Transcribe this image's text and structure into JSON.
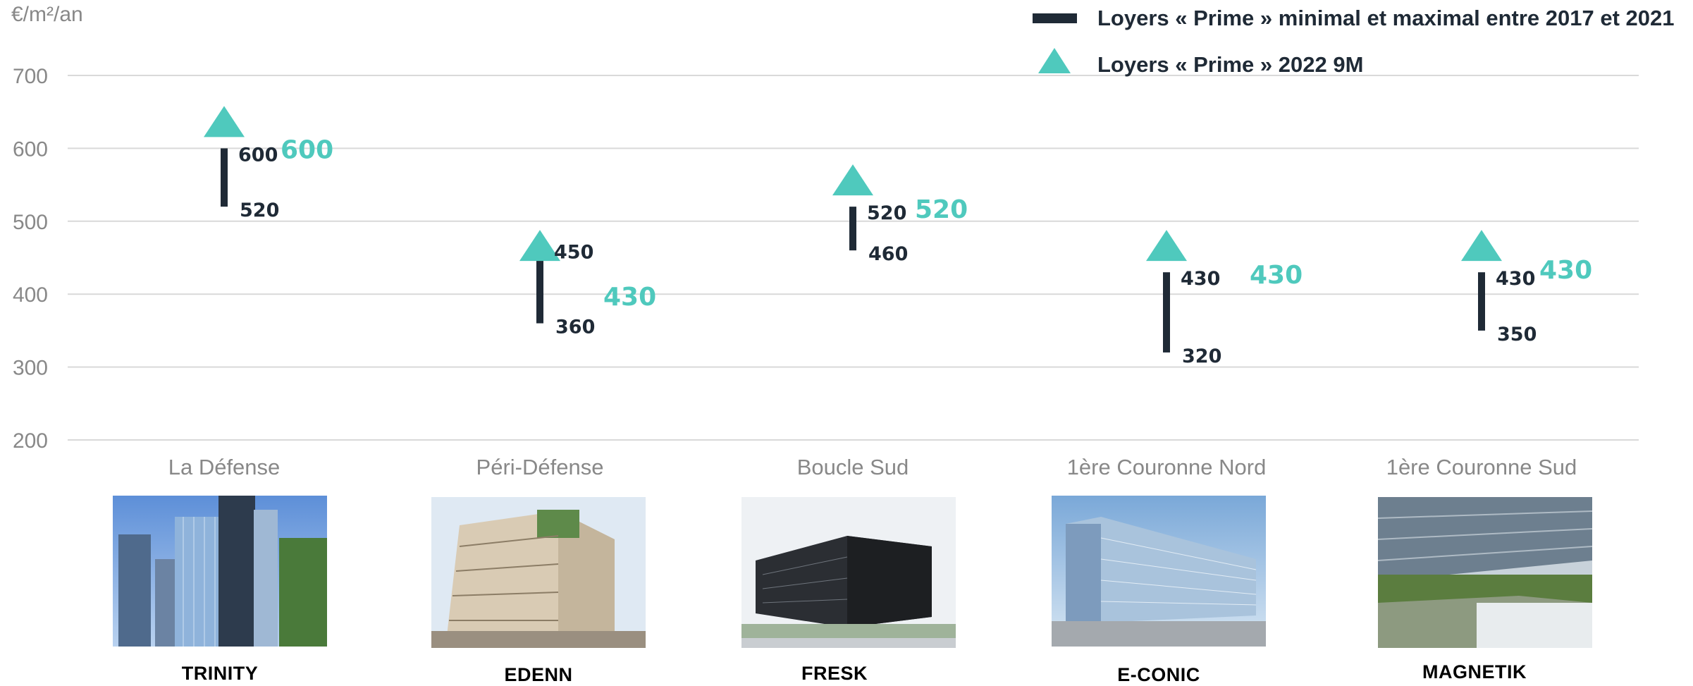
{
  "chart_data": {
    "type": "range",
    "ylabel": "€/m²/an",
    "ylim": [
      200,
      700
    ],
    "yticks": [
      700,
      600,
      500,
      400,
      300,
      200
    ],
    "grid": true,
    "legend_position": "top-right",
    "legend": [
      {
        "marker": "bar",
        "label": "Loyers « Prime » minimal et maximal entre 2017 et 2021"
      },
      {
        "marker": "triangle",
        "label": "Loyers « Prime » 2022 9M"
      }
    ],
    "categories": [
      "La Défense",
      "Péri-Défense",
      "Boucle Sud",
      "1ère Couronne Nord",
      "1ère Couronne Sud"
    ],
    "series": [
      {
        "name": "Loyers « Prime » minimal et maximal entre 2017 et 2021",
        "min": [
          520,
          360,
          460,
          320,
          350
        ],
        "max": [
          600,
          450,
          520,
          430,
          430
        ]
      },
      {
        "name": "Loyers « Prime » 2022 9M",
        "values": [
          600,
          430,
          520,
          430,
          430
        ]
      }
    ],
    "colors": {
      "range": "#1f2a36",
      "marker": "#4fc9bd",
      "axis_text": "#888888",
      "grid": "#d9d9d9"
    }
  },
  "buildings": [
    {
      "name": "TRINITY",
      "image": "office-tower-photo"
    },
    {
      "name": "EDENN",
      "image": "green-facade-building-photo"
    },
    {
      "name": "FRESK",
      "image": "dark-glass-office-photo"
    },
    {
      "name": "E-CONIC",
      "image": "glass-office-riverside-photo"
    },
    {
      "name": "MAGNETIK",
      "image": "atrium-garden-photo"
    }
  ]
}
